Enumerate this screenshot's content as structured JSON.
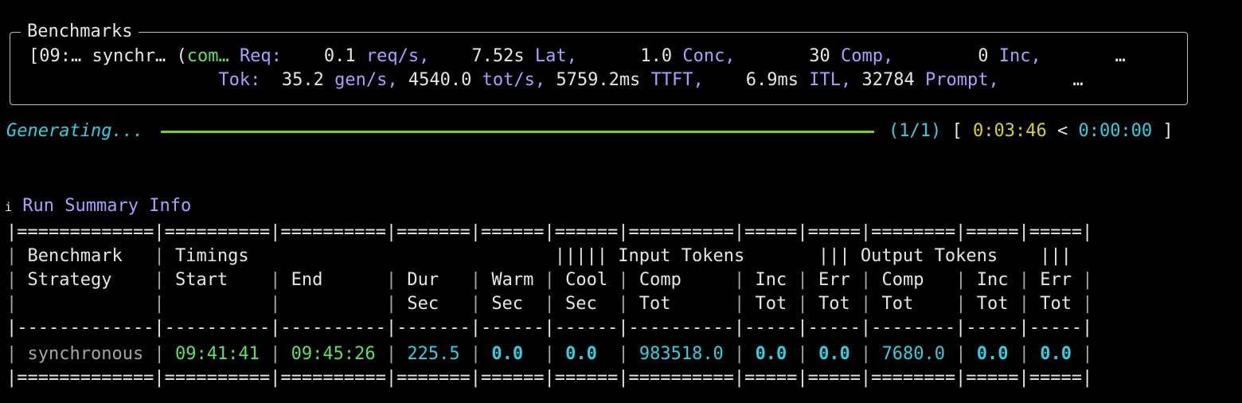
{
  "panel": {
    "title": "Benchmarks",
    "row1": {
      "ts": "[09:…",
      "strategy": "synchr…",
      "status_open": "(",
      "status": "com…",
      "label": "Req:",
      "cells": [
        {
          "num": "0.1",
          "unit": "req/s,"
        },
        {
          "num": "7.52s",
          "unit": "Lat,"
        },
        {
          "num": "1.0",
          "unit": "Conc,"
        },
        {
          "num": "30",
          "unit": "Comp,"
        },
        {
          "num": "0",
          "unit": "Inc,"
        }
      ],
      "more": "…"
    },
    "row2": {
      "label": "Tok:",
      "cells": [
        {
          "num": "35.2",
          "unit": "gen/s,"
        },
        {
          "num": "4540.0",
          "unit": "tot/s,"
        },
        {
          "num": "5759.2ms",
          "unit": "TTFT,"
        },
        {
          "num": "6.9ms",
          "unit": "ITL,"
        },
        {
          "num": "32784",
          "unit": "Prompt,"
        }
      ],
      "more": "…"
    }
  },
  "progress": {
    "label": "Generating...",
    "fraction": 1.0,
    "count": "(1/1)",
    "bracket_open": "[",
    "elapsed": "0:03:46",
    "sep": "<",
    "remaining": "0:00:00",
    "bracket_close": "]"
  },
  "summary": {
    "info_icon": "i",
    "title": "Run Summary Info",
    "sep_eq": "|=============|==========|==========|=======|======|======|==========|=====|=====|========|=====|=====|",
    "sep_dash": "|-------------|----------|----------|-------|------|------|----------|-----|-----|--------|-----|-----|",
    "hdr1": {
      "a": "| ",
      "benchmark": "Benchmark",
      "b": "   | ",
      "timings": "Timings",
      "c": "                             ||||| ",
      "input_tokens": "Input Tokens",
      "d": "       ||| ",
      "output_tokens": "Output Tokens",
      "e": "    |||"
    },
    "hdr2": [
      "| ",
      "Strategy",
      "    | ",
      "Start",
      "    | ",
      "End",
      "      | ",
      "Dur",
      "   | ",
      "Warm",
      " | ",
      "Cool",
      " | ",
      "Comp",
      "     | ",
      "Inc",
      " | ",
      "Err",
      " | ",
      "Comp",
      "   | ",
      "Inc",
      " | ",
      "Err",
      " |"
    ],
    "hdr3": [
      "|             |          |          | ",
      "Sec",
      "   | ",
      "Sec",
      "  | ",
      "Sec",
      "  | ",
      "Tot",
      "      | ",
      "Tot",
      " | ",
      "Tot",
      " | ",
      "Tot",
      "    | ",
      "Tot",
      " | ",
      "Tot",
      " |"
    ],
    "row": {
      "strategy": "synchronous",
      "start": "09:41:41",
      "end": "09:45:26",
      "dur": "225.5",
      "warm": "0.0",
      "cool": "0.0",
      "input_comp": "983518.0",
      "input_inc": "0.0",
      "input_err": "0.0",
      "output_comp": "7680.0",
      "output_inc": "0.0",
      "output_err": "0.0"
    }
  }
}
